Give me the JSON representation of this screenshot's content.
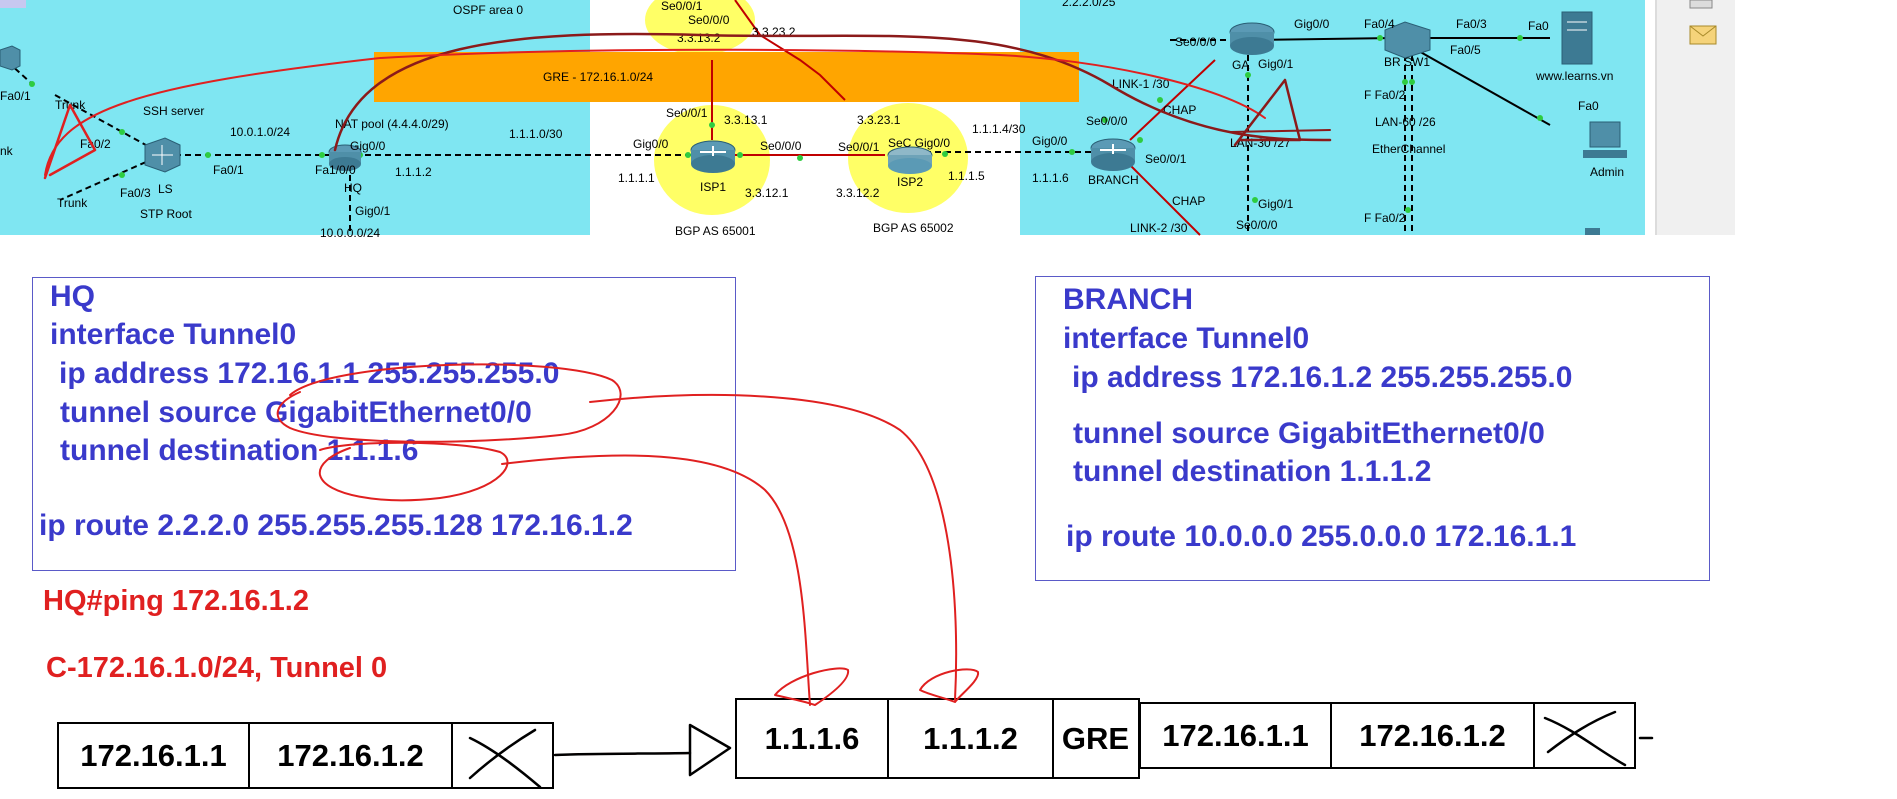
{
  "topology": {
    "labels": {
      "ospf": "OSPF area 0",
      "net_2220": "2.2.2.0/25",
      "se001_isp1_top": "Se0/0/1",
      "se000_isp1_top": "Se0/0/0",
      "ip_33132": "3.3.13.2",
      "ip_33232_top": "3.3.23.2",
      "gre": "GRE - 172.16.1.0/24",
      "trunk1": "Trunk",
      "trunk2": "Trunk",
      "fa01_left": "Fa0/1",
      "fa02": "Fa0/2",
      "fa03": "Fa0/3",
      "nk": "nk",
      "ssh": "SSH server",
      "ls": "LS",
      "stp": "STP Root",
      "net_10010": "10.0.1.0/24",
      "fa01_ls": "Fa0/1",
      "nat": "NAT pool (4.4.4.0/29)",
      "hq_gig00": "Gig0/0",
      "hq_fa10": "Fa1/0/0",
      "hq": "HQ",
      "ip_1112": "1.1.1.2",
      "hq_gig01": "Gig0/1",
      "net_10000": "10.0.0.0/24",
      "net_1110": "1.1.1.0/30",
      "isp1_gig00": "Gig0/0",
      "ip_1111": "1.1.1.1",
      "isp1_se001": "Se0/0/1",
      "ip_33131": "3.3.13.1",
      "isp1_se000": "Se0/0/0",
      "isp1": "ISP1",
      "ip_33121": "3.3.12.1",
      "bgp1": "BGP AS 65001",
      "ip_33231": "3.3.23.1",
      "isp2_se001": "Se0/0/1",
      "isp2_gig00": "SeC Gig0/0",
      "isp2": "ISP2",
      "ip_33122": "3.3.12.2",
      "bgp2": "BGP AS 65002",
      "ip_1115": "1.1.1.5",
      "net_1114": "1.1.1.4/30",
      "br_gig00": "Gig0/0",
      "ip_1116": "1.1.1.6",
      "br_se000": "Se0/0/0",
      "br_se001": "Se0/0/1",
      "branch": "BRANCH",
      "link1": "LINK-1 /30",
      "chap1": "CHAP",
      "chap2": "CHAP",
      "link2": "LINK-2 /30",
      "ga_se000": "Se0/0/0",
      "ga": "GA",
      "ga_gig00": "Gig0/0",
      "ga_gig01": "Gig0/1",
      "lan30": "LAN-30 /27",
      "bot_gig01": "Gig0/1",
      "bot_se000": "Se0/0/0",
      "fa04": "Fa0/4",
      "brsw1": "BR SW1",
      "fa03_r": "Fa0/3",
      "fa05": "Fa0/5",
      "fa0_srv": "Fa0",
      "f_fa02_a": "F Fa0/2",
      "lan60": "LAN-60 /26",
      "ether": "EtherChannel",
      "f_fa02_b": "F Fa0/2",
      "www": "www.learns.vn",
      "fa0_admin": "Fa0",
      "admin": "Admin"
    }
  },
  "hq_config": {
    "lines": [
      "HQ",
      "interface Tunnel0",
      "ip address 172.16.1.1 255.255.255.0",
      "tunnel source GigabitEthernet0/0",
      "tunnel destination 1.1.1.6",
      "ip route 2.2.2.0 255.255.255.128 172.16.1.2"
    ]
  },
  "branch_config": {
    "lines": [
      "BRANCH",
      "interface Tunnel0",
      "ip address 172.16.1.2 255.255.255.0",
      "tunnel source GigabitEthernet0/0",
      "tunnel destination 1.1.1.2",
      "ip route 10.0.0.0 255.0.0.0 172.16.1.1"
    ]
  },
  "notes": {
    "ping": "HQ#ping 172.16.1.2",
    "route": "C-172.16.1.0/24, Tunnel 0"
  },
  "packets": {
    "original": [
      "172.16.1.1",
      "172.16.1.2"
    ],
    "outer": [
      "1.1.1.6",
      "1.1.1.2",
      "GRE"
    ],
    "inner": [
      "172.16.1.1",
      "172.16.1.2"
    ]
  },
  "colors": {
    "cfg_text": "#3a3acb",
    "note_text": "#e02020",
    "zone_cyan": "#7fe6f2",
    "gre_band": "#ffa500",
    "bgp_yellow": "#ffff66",
    "annotation_red": "#e02020"
  }
}
